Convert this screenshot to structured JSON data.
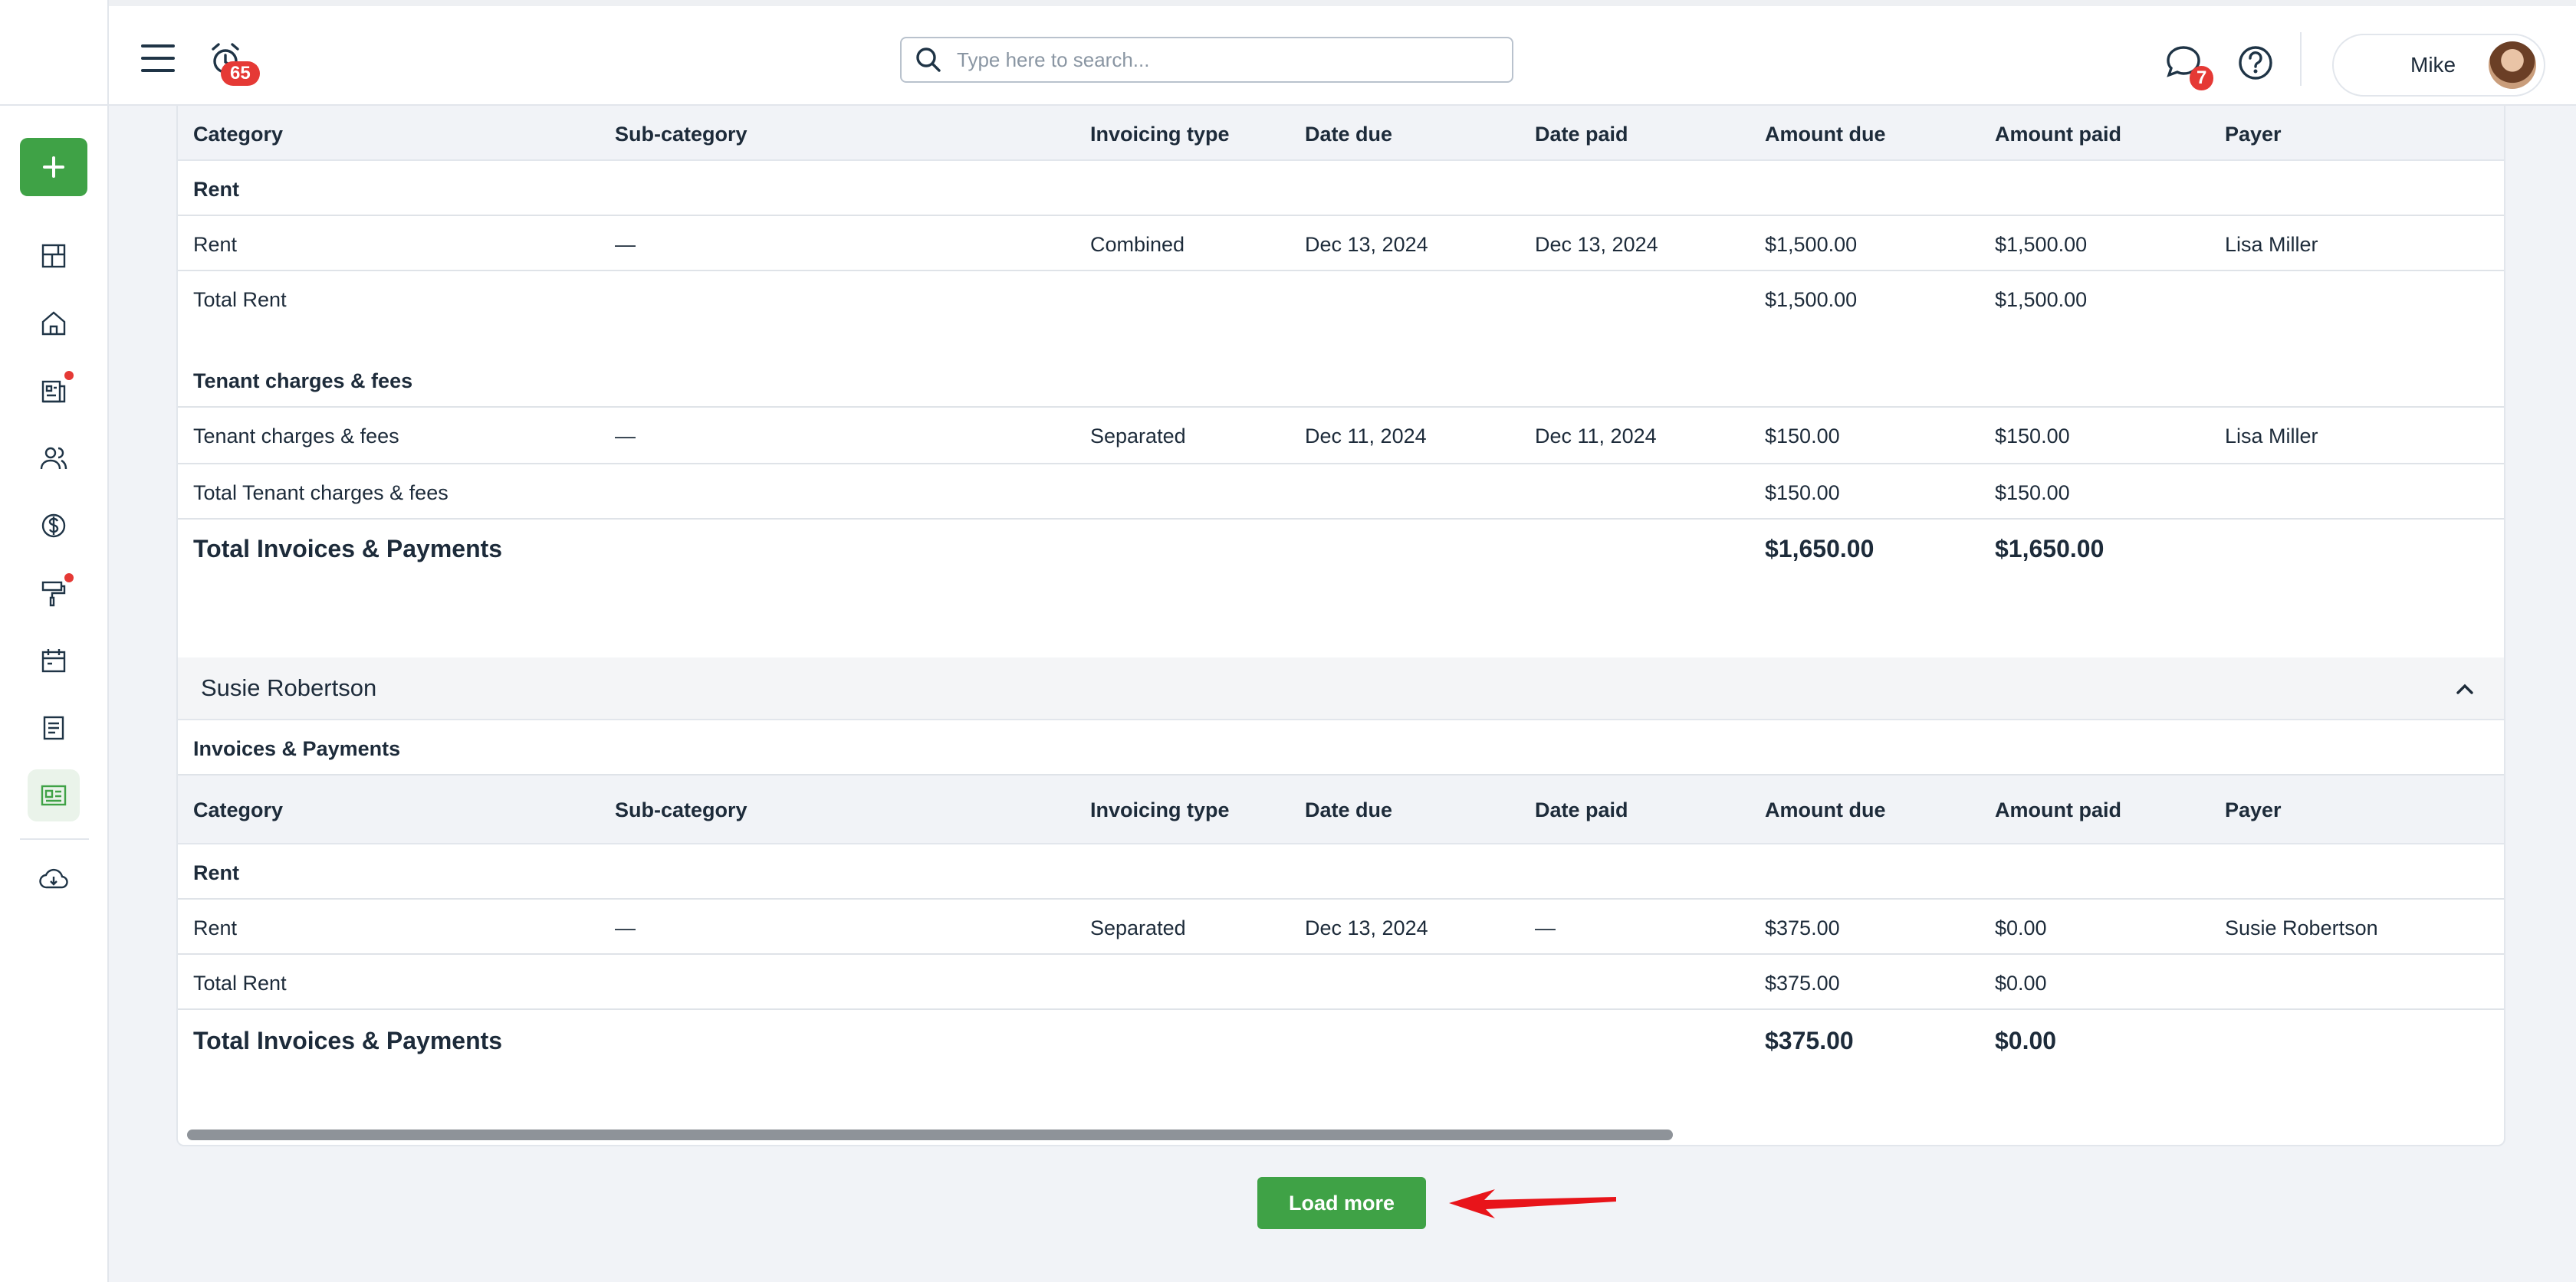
{
  "topbar": {
    "search_placeholder": "Type here to search...",
    "alarm_count": "65",
    "messages_count": "7",
    "user_name": "Mike"
  },
  "table_headers": [
    "Category",
    "Sub-category",
    "Invoicing type",
    "Date due",
    "Date paid",
    "Amount due",
    "Amount paid",
    "Payer"
  ],
  "section1": {
    "rent_label": "Rent",
    "rent_row": [
      "Rent",
      "—",
      "Combined",
      "Dec 13, 2024",
      "Dec 13, 2024",
      "$1,500.00",
      "$1,500.00",
      "Lisa Miller"
    ],
    "total_rent": [
      "Total Rent",
      "$1,500.00",
      "$1,500.00"
    ],
    "fees_label": "Tenant charges & fees",
    "fees_row": [
      "Tenant charges & fees",
      "—",
      "Separated",
      "Dec 11, 2024",
      "Dec 11, 2024",
      "$150.00",
      "$150.00",
      "Lisa Miller"
    ],
    "total_fees": [
      "Total Tenant charges & fees",
      "$150.00",
      "$150.00"
    ],
    "grand_total": [
      "Total Invoices & Payments",
      "$1,650.00",
      "$1,650.00"
    ]
  },
  "section2": {
    "tenant_name": "Susie Robertson",
    "subtitle": "Invoices & Payments",
    "rent_label": "Rent",
    "rent_row": [
      "Rent",
      "—",
      "Separated",
      "Dec 13, 2024",
      "—",
      "$375.00",
      "$0.00",
      "Susie Robertson"
    ],
    "total_rent": [
      "Total Rent",
      "$375.00",
      "$0.00"
    ],
    "grand_total": [
      "Total Invoices & Payments",
      "$375.00",
      "$0.00"
    ]
  },
  "load_more_label": "Load more"
}
